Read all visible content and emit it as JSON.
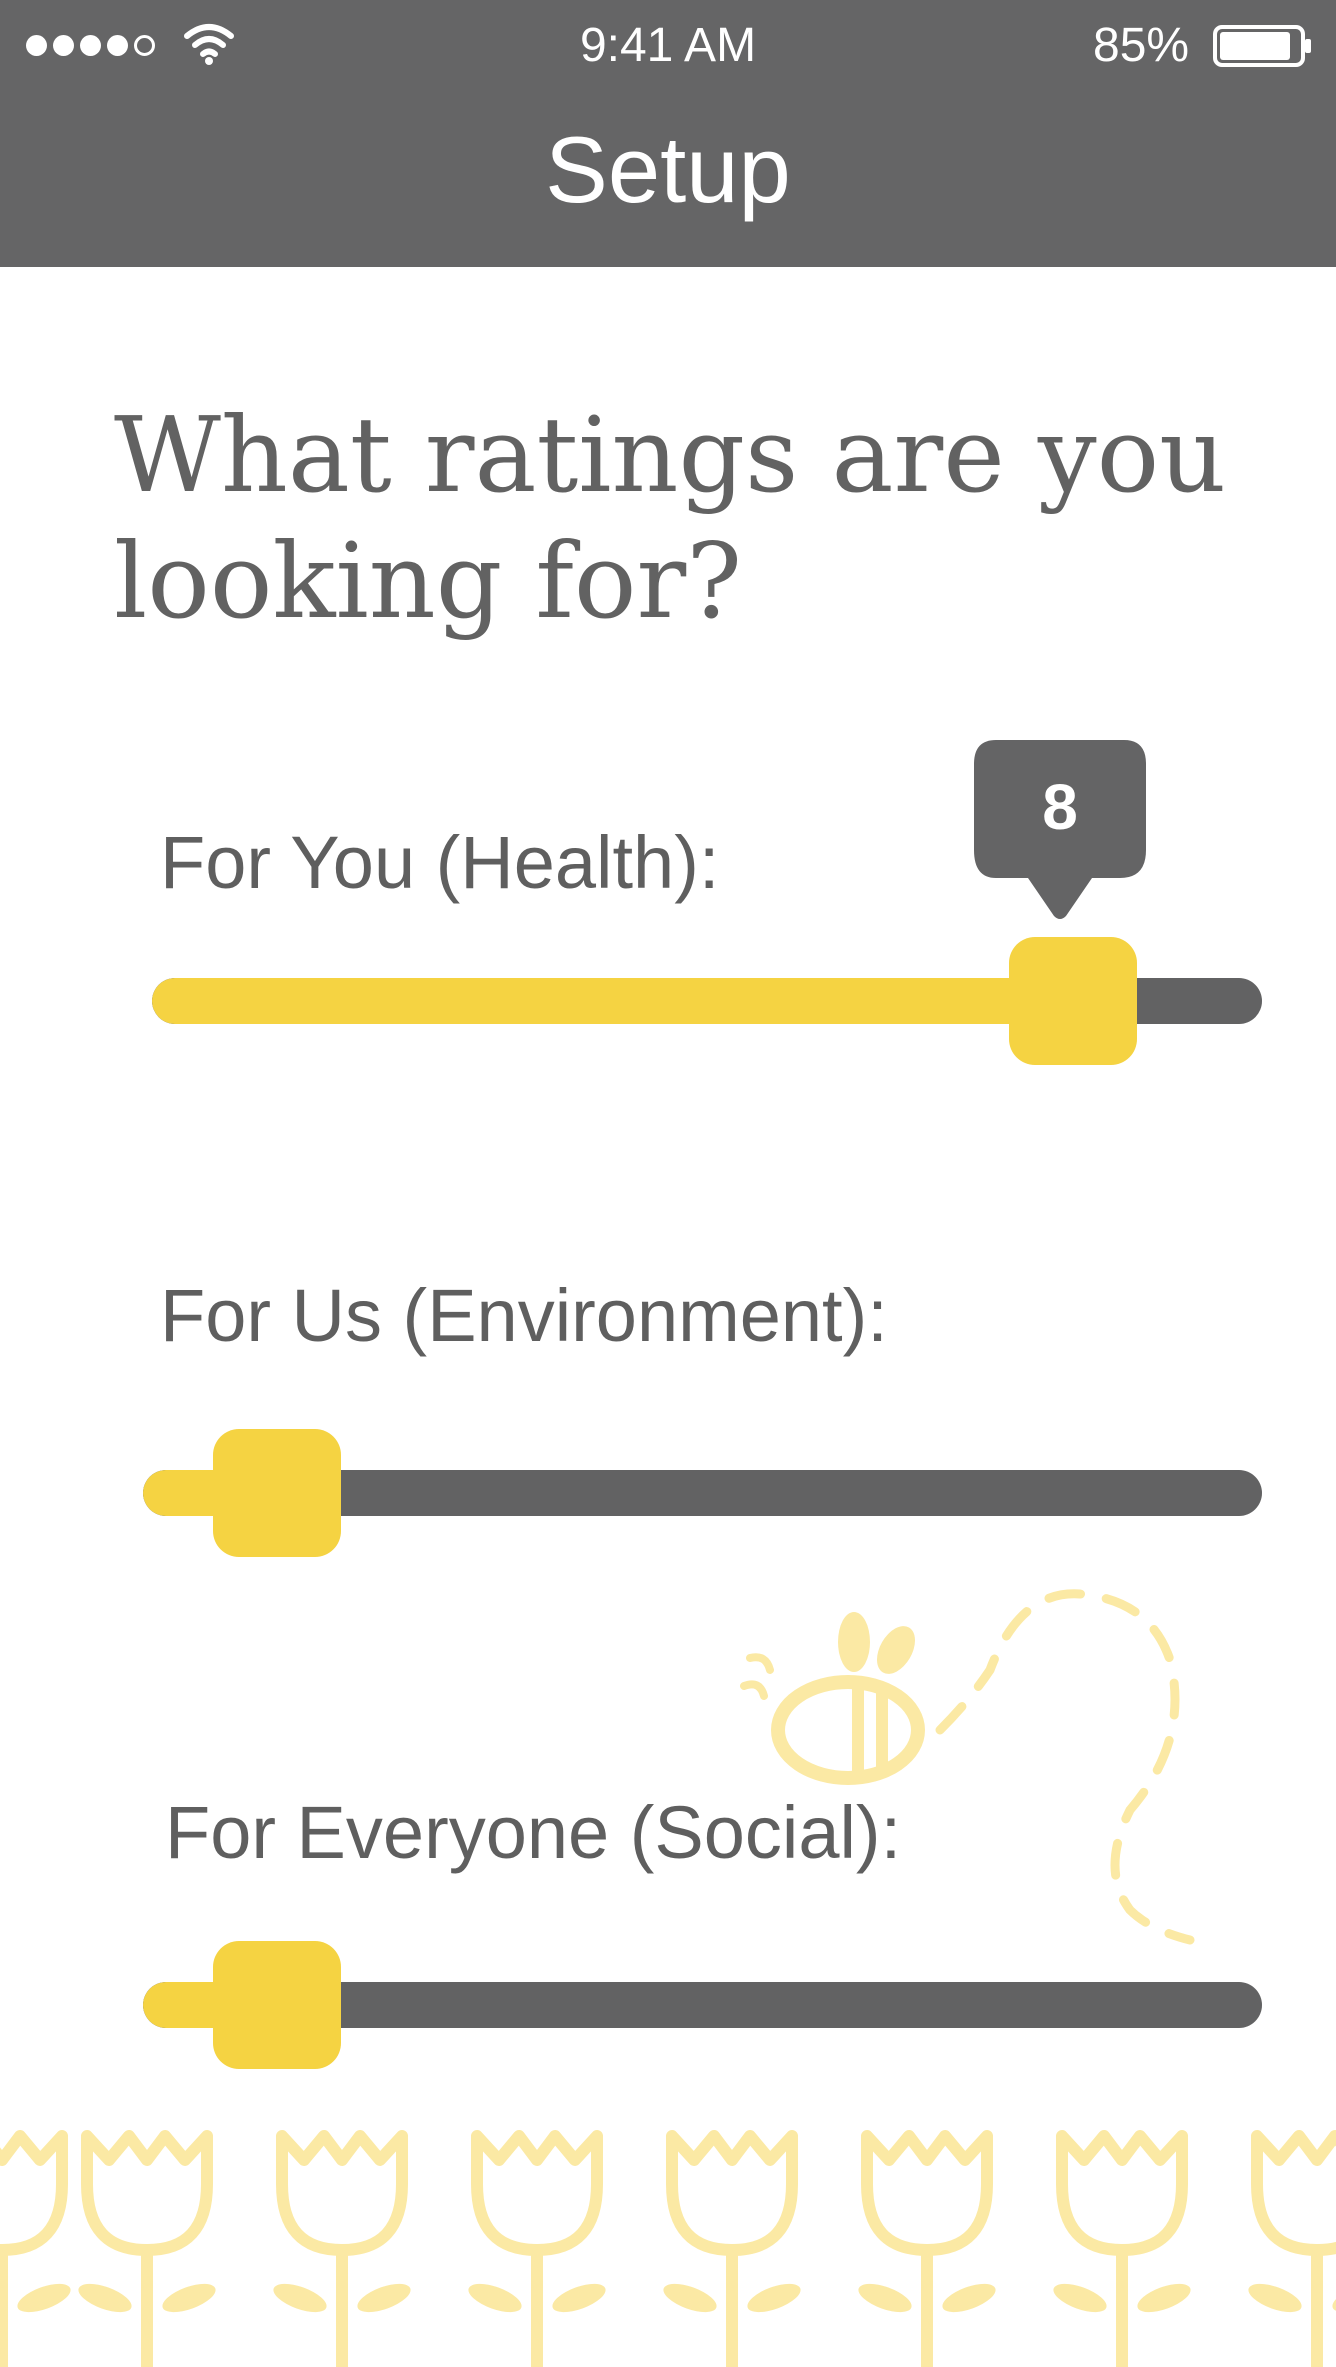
{
  "status_bar": {
    "time": "9:41 AM",
    "battery_percent": "85%",
    "signal_bars": 4,
    "signal_icon": "signal-dots-icon",
    "wifi_icon": "wifi-icon",
    "battery_icon": "battery-icon"
  },
  "header": {
    "title": "Setup"
  },
  "question": "What ratings are you looking for?",
  "sliders": [
    {
      "label": "For You (Health):",
      "value": 8,
      "value_text": "8",
      "fraction": 0.83,
      "show_value_bubble": true
    },
    {
      "label": "For Us (Environment):",
      "fraction": 0.12,
      "show_value_bubble": false
    },
    {
      "label": "For Everyone (Social):",
      "fraction": 0.12,
      "show_value_bubble": false
    }
  ],
  "decorations": {
    "bee_icon": "bee-icon",
    "flower_icon": "tulip-icon"
  },
  "colors": {
    "header": "#656566",
    "accent_yellow": "#f5d342",
    "track_gray": "#626263",
    "text_gray": "#626262",
    "decor_yellow": "#fbe9a4"
  }
}
